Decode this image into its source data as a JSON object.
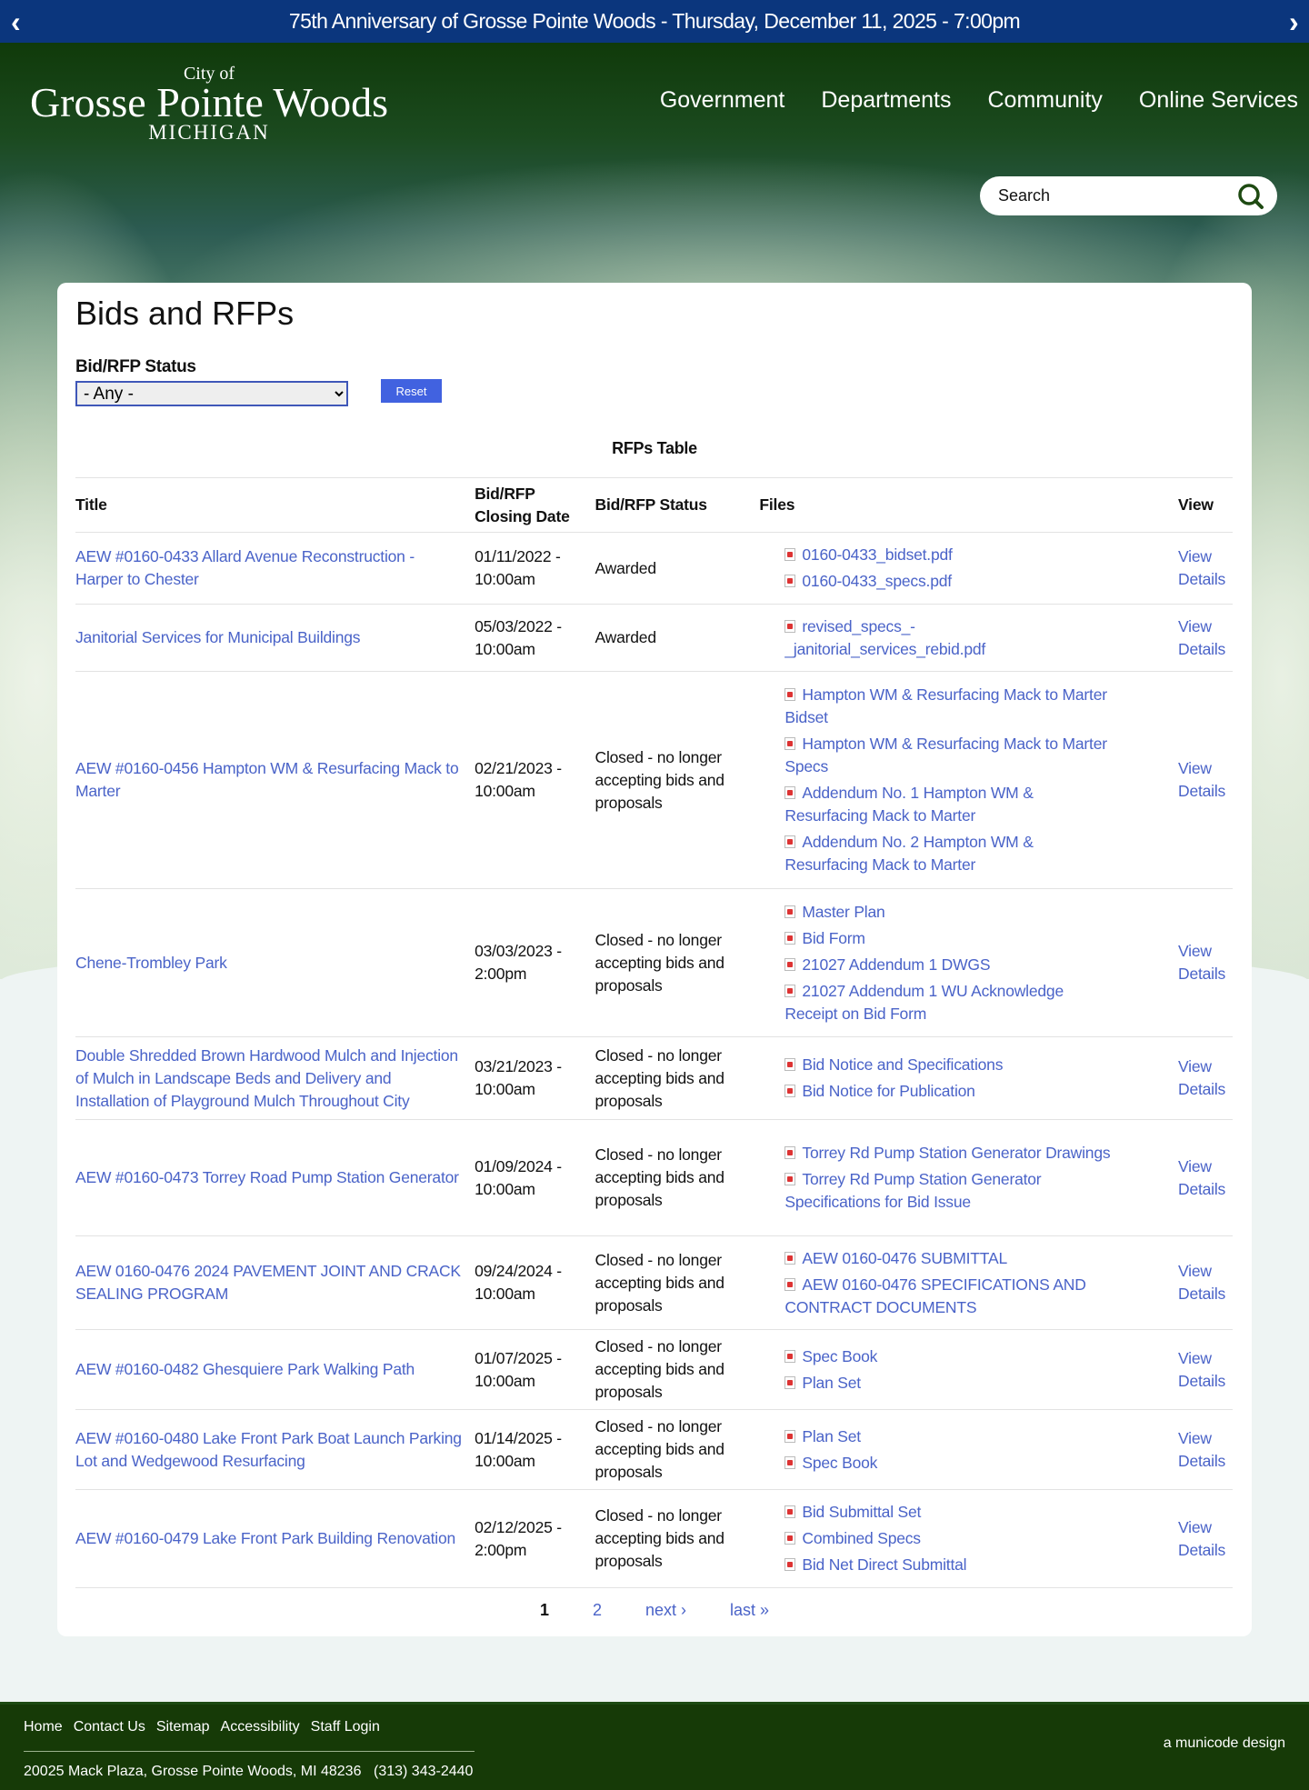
{
  "banner": {
    "text": "75th Anniversary of Grosse Pointe Woods - Thursday, December 11, 2025 - 7:00pm",
    "prev": "‹",
    "next": "›"
  },
  "logo": {
    "city": "City of",
    "name": "Grosse Pointe Woods",
    "state": "MICHIGAN"
  },
  "nav": [
    "Government",
    "Departments",
    "Community",
    "Online Services"
  ],
  "search": {
    "placeholder": "Search"
  },
  "page": {
    "title": "Bids and RFPs",
    "filter_label": "Bid/RFP Status",
    "filter_value": "- Any -",
    "reset": "Reset",
    "caption": "RFPs Table"
  },
  "table": {
    "headers": [
      "Title",
      "Bid/RFP Closing Date",
      "Bid/RFP Status",
      "Files",
      "View"
    ],
    "rows": [
      {
        "title": "AEW #0160-0433 Allard Avenue Reconstruction - Harper to Chester",
        "date": "01/11/2022 - 10:00am",
        "status": "Awarded",
        "files": [
          "0160-0433_bidset.pdf",
          "0160-0433_specs.pdf"
        ]
      },
      {
        "title": "Janitorial Services for Municipal Buildings",
        "date": "05/03/2022 - 10:00am",
        "status": "Awarded",
        "files": [
          "revised_specs_-_janitorial_services_rebid.pdf"
        ]
      },
      {
        "title": "AEW #0160-0456 Hampton WM & Resurfacing Mack to Marter",
        "date": "02/21/2023 - 10:00am",
        "status": "Closed - no longer accepting bids and proposals",
        "files": [
          "Hampton WM & Resurfacing Mack to Marter Bidset",
          "Hampton WM & Resurfacing Mack to Marter Specs",
          "Addendum No. 1 Hampton WM & Resurfacing Mack to Marter",
          "Addendum No. 2 Hampton WM & Resurfacing Mack to Marter"
        ]
      },
      {
        "title": "Chene-Trombley Park",
        "date": "03/03/2023 - 2:00pm",
        "status": "Closed - no longer accepting bids and proposals",
        "files": [
          "Master Plan",
          "Bid Form",
          "21027 Addendum 1 DWGS",
          "21027 Addendum 1 WU Acknowledge Receipt on Bid Form"
        ]
      },
      {
        "title": "Double Shredded Brown Hardwood Mulch and Injection of Mulch in Landscape Beds and Delivery and Installation of Playground Mulch Throughout City",
        "date": "03/21/2023 - 10:00am",
        "status": "Closed - no longer accepting bids and proposals",
        "files": [
          "Bid Notice and Specifications",
          "Bid Notice for Publication"
        ]
      },
      {
        "title": "AEW #0160-0473 Torrey Road Pump Station Generator",
        "date": "01/09/2024 - 10:00am",
        "status": "Closed - no longer accepting bids and proposals",
        "files": [
          "Torrey Rd Pump Station Generator Drawings",
          "Torrey Rd Pump Station Generator Specifications for Bid Issue"
        ]
      },
      {
        "title": "AEW 0160-0476 2024 PAVEMENT JOINT AND CRACK SEALING PROGRAM",
        "date": "09/24/2024 - 10:00am",
        "status": "Closed - no longer accepting bids and proposals",
        "files": [
          "AEW 0160-0476 SUBMITTAL",
          "AEW 0160-0476 SPECIFICATIONS AND CONTRACT DOCUMENTS"
        ]
      },
      {
        "title": "AEW #0160-0482 Ghesquiere Park Walking Path",
        "date": "01/07/2025 - 10:00am",
        "status": "Closed - no longer accepting bids and proposals",
        "files": [
          "Spec Book",
          "Plan Set"
        ]
      },
      {
        "title": "AEW #0160-0480 Lake Front Park Boat Launch Parking Lot and Wedgewood Resurfacing",
        "date": "01/14/2025 - 10:00am",
        "status": "Closed - no longer accepting bids and proposals",
        "files": [
          "Plan Set",
          "Spec Book"
        ]
      },
      {
        "title": "AEW #0160-0479 Lake Front Park Building Renovation",
        "date": "02/12/2025 - 2:00pm",
        "status": "Closed - no longer accepting bids and proposals",
        "files": [
          "Bid Submittal Set",
          "Combined Specs",
          "Bid Net Direct Submittal"
        ]
      }
    ],
    "view_label": "View Details"
  },
  "pager": {
    "current": "1",
    "page2": "2",
    "next": "next ›",
    "last": "last »"
  },
  "footer": {
    "links": [
      "Home",
      "Contact Us",
      "Sitemap",
      "Accessibility",
      "Staff Login"
    ],
    "address": "20025 Mack Plaza, Grosse Pointe Woods, MI 48236",
    "phone": "(313) 343-2440",
    "credit": "a municode design"
  },
  "colors": {
    "banner": "#0b367d",
    "link": "#4a63c8",
    "button": "#4162e0",
    "footer": "#163a07"
  }
}
